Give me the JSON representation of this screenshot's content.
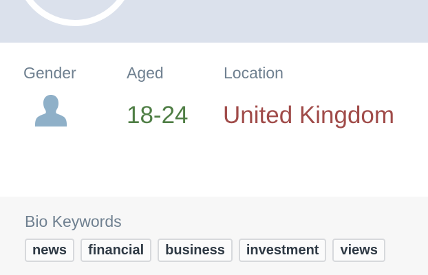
{
  "labels": {
    "gender": "Gender",
    "aged": "Aged",
    "location": "Location"
  },
  "values": {
    "gender_icon": "person-silhouette-icon",
    "aged": "18-24",
    "location": "United Kingdom"
  },
  "bio": {
    "title": "Bio Keywords",
    "keywords": [
      "news",
      "financial",
      "business",
      "investment",
      "views"
    ]
  },
  "colors": {
    "banner": "#dbe1ec",
    "label": "#6f8090",
    "aged": "#4f7e45",
    "location": "#a04b49",
    "icon": "#8fb0c8"
  }
}
